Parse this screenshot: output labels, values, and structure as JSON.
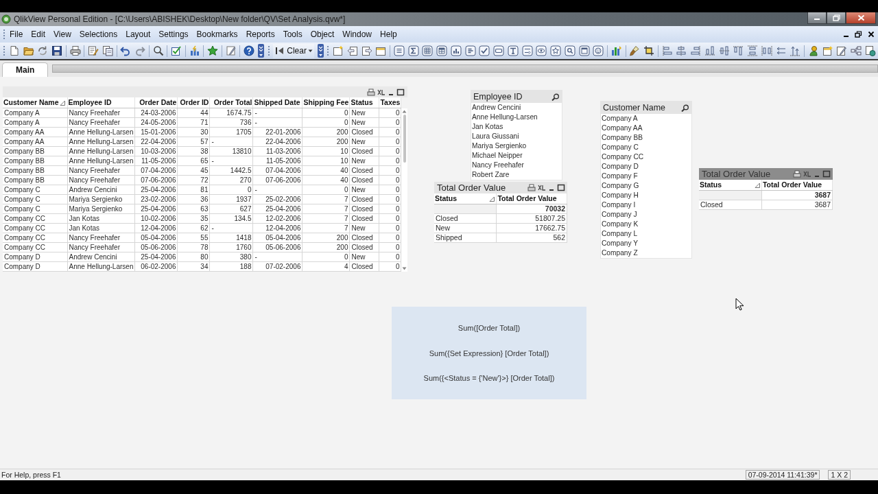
{
  "window": {
    "title": "QlikView Personal Edition - [C:\\Users\\ABISHEK\\Desktop\\New folder\\QV\\Set Analysis.qvw*]"
  },
  "menu": [
    "File",
    "Edit",
    "View",
    "Selections",
    "Layout",
    "Settings",
    "Bookmarks",
    "Reports",
    "Tools",
    "Object",
    "Window",
    "Help"
  ],
  "toolbar": {
    "clear_button": "Clear"
  },
  "sheet_tabs": [
    {
      "label": "Main",
      "selected": true
    }
  ],
  "table_box": {
    "columns": [
      {
        "label": "Customer Name",
        "sorted": true
      },
      {
        "label": "Employee ID",
        "sorted": false
      },
      {
        "label": "Order Date",
        "sorted": false
      },
      {
        "label": "Order ID",
        "sorted": false
      },
      {
        "label": "Order Total",
        "sorted": false
      },
      {
        "label": "Shipped Date",
        "sorted": false
      },
      {
        "label": "Shipping Fee",
        "sorted": false
      },
      {
        "label": "Status",
        "sorted": false
      },
      {
        "label": "Taxes",
        "sorted": false
      }
    ],
    "rows": [
      [
        "Company A",
        "Nancy Freehafer",
        "24-03-2006",
        "44",
        "1674.75",
        "-",
        "0",
        "New",
        "0"
      ],
      [
        "Company A",
        "Nancy Freehafer",
        "24-05-2006",
        "71",
        "736",
        "-",
        "0",
        "New",
        "0"
      ],
      [
        "Company AA",
        "Anne Hellung-Larsen",
        "15-01-2006",
        "30",
        "1705",
        "22-01-2006",
        "200",
        "Closed",
        "0"
      ],
      [
        "Company AA",
        "Anne Hellung-Larsen",
        "22-04-2006",
        "57",
        "-",
        "22-04-2006",
        "200",
        "New",
        "0"
      ],
      [
        "Company BB",
        "Anne Hellung-Larsen",
        "10-03-2006",
        "38",
        "13810",
        "11-03-2006",
        "10",
        "Closed",
        "0"
      ],
      [
        "Company BB",
        "Anne Hellung-Larsen",
        "11-05-2006",
        "65",
        "-",
        "11-05-2006",
        "10",
        "New",
        "0"
      ],
      [
        "Company BB",
        "Nancy Freehafer",
        "07-04-2006",
        "45",
        "1442.5",
        "07-04-2006",
        "40",
        "Closed",
        "0"
      ],
      [
        "Company BB",
        "Nancy Freehafer",
        "07-06-2006",
        "72",
        "270",
        "07-06-2006",
        "40",
        "Closed",
        "0"
      ],
      [
        "Company C",
        "Andrew Cencini",
        "25-04-2006",
        "81",
        "0",
        "-",
        "0",
        "New",
        "0"
      ],
      [
        "Company C",
        "Mariya Sergienko",
        "23-02-2006",
        "36",
        "1937",
        "25-02-2006",
        "7",
        "Closed",
        "0"
      ],
      [
        "Company C",
        "Mariya Sergienko",
        "25-04-2006",
        "63",
        "627",
        "25-04-2006",
        "7",
        "Closed",
        "0"
      ],
      [
        "Company CC",
        "Jan Kotas",
        "10-02-2006",
        "35",
        "134.5",
        "12-02-2006",
        "7",
        "Closed",
        "0"
      ],
      [
        "Company CC",
        "Jan Kotas",
        "12-04-2006",
        "62",
        "-",
        "12-04-2006",
        "7",
        "New",
        "0"
      ],
      [
        "Company CC",
        "Nancy Freehafer",
        "05-04-2006",
        "55",
        "1418",
        "05-04-2006",
        "200",
        "Closed",
        "0"
      ],
      [
        "Company CC",
        "Nancy Freehafer",
        "05-06-2006",
        "78",
        "1760",
        "05-06-2006",
        "200",
        "Closed",
        "0"
      ],
      [
        "Company D",
        "Andrew Cencini",
        "25-04-2006",
        "80",
        "380",
        "-",
        "0",
        "New",
        "0"
      ],
      [
        "Company D",
        "Anne Hellung-Larsen",
        "06-02-2006",
        "34",
        "188",
        "07-02-2006",
        "4",
        "Closed",
        "0"
      ]
    ]
  },
  "list_boxes": [
    {
      "title": "Employee ID",
      "items": [
        "Andrew Cencini",
        "Anne Hellung-Larsen",
        "Jan Kotas",
        "Laura Giussani",
        "Mariya Sergienko",
        "Michael Neipper",
        "Nancy Freehafer",
        "Robert Zare"
      ]
    },
    {
      "title": "Customer Name",
      "items": [
        "Company A",
        "Company AA",
        "Company BB",
        "Company C",
        "Company CC",
        "Company D",
        "Company F",
        "Company G",
        "Company H",
        "Company I",
        "Company J",
        "Company K",
        "Company L",
        "Company Y",
        "Company Z"
      ]
    }
  ],
  "charts": [
    {
      "title": "Total Order Value",
      "active": false,
      "columns": [
        {
          "label": "Status",
          "sorted": true
        },
        {
          "label": "Total Order Value",
          "sorted": false
        }
      ],
      "total": "70032",
      "rows": [
        [
          "Closed",
          "51807.25"
        ],
        [
          "New",
          "17662.75"
        ],
        [
          "Shipped",
          "562"
        ]
      ]
    },
    {
      "title": "Total Order Value",
      "active": true,
      "columns": [
        {
          "label": "Status",
          "sorted": true
        },
        {
          "label": "Total Order Value",
          "sorted": false
        }
      ],
      "total": "3687",
      "rows": [
        [
          "Closed",
          "3687"
        ]
      ]
    }
  ],
  "text_box": {
    "lines": [
      "Sum([Order Total])",
      "Sum({Set Expression} [Order Total])",
      "Sum({<Status = {'New'}>} [Order Total])"
    ]
  },
  "status_bar": {
    "help": "For Help, press F1",
    "timestamp": "07-09-2014 11:41:39*",
    "grid": "1 X 2"
  }
}
